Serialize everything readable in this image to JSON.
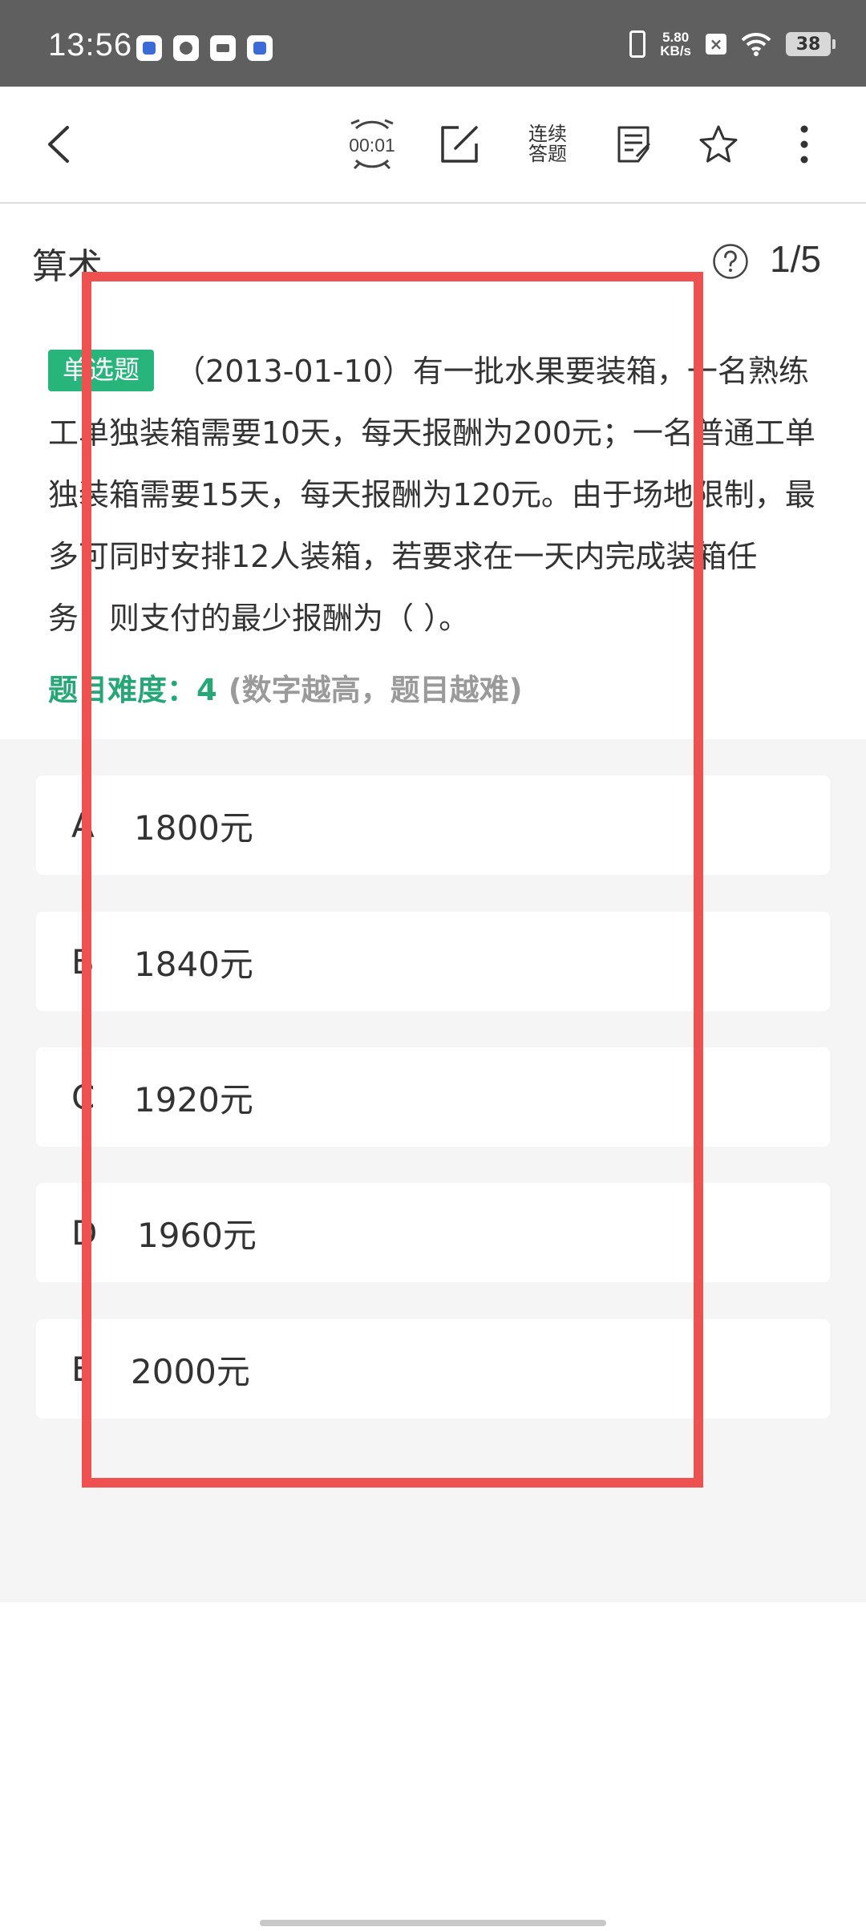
{
  "status_bar": {
    "time": "13:56",
    "net_speed_value": "5.80",
    "net_speed_unit": "KB/s",
    "battery": "38"
  },
  "toolbar": {
    "timer": "00:01",
    "continuous_line1": "连续",
    "continuous_line2": "答题"
  },
  "header": {
    "category": "算术",
    "progress": "1/5"
  },
  "question": {
    "type_badge": "单选题",
    "text": "（2013-01-10）有一批水果要装箱，一名熟练工单独装箱需要10天，每天报酬为200元；一名普通工单独装箱需要15天，每天报酬为120元。由于场地限制，最多可同时安排12人装箱，若要求在一天内完成装箱任务，则支付的最少报酬为（ ）。",
    "difficulty_label": "题目难度：4",
    "difficulty_note": "(数字越高，题目越难)"
  },
  "options": [
    {
      "letter": "A",
      "text": "1800元"
    },
    {
      "letter": "B",
      "text": "1840元"
    },
    {
      "letter": "C",
      "text": "1920元"
    },
    {
      "letter": "D",
      "text": "1960元"
    },
    {
      "letter": "E",
      "text": "2000元"
    }
  ],
  "colors": {
    "accent_green": "#27b57b",
    "highlight_red": "#ee5150",
    "status_bar_bg": "#5f5f5f"
  }
}
